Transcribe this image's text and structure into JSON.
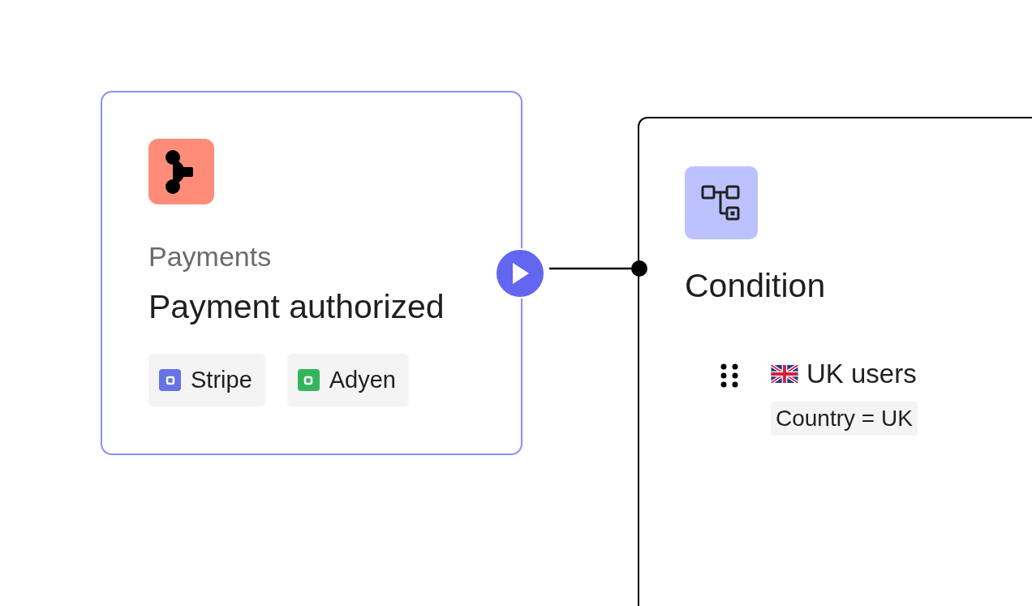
{
  "trigger": {
    "category": "Payments",
    "title": "Payment authorized",
    "integrations": [
      {
        "name": "Stripe",
        "color": "#6772e5"
      },
      {
        "name": "Adyen",
        "color": "#33b55c"
      }
    ]
  },
  "condition": {
    "title": "Condition",
    "rules": [
      {
        "label": "UK users",
        "expression": "Country = UK"
      }
    ]
  }
}
